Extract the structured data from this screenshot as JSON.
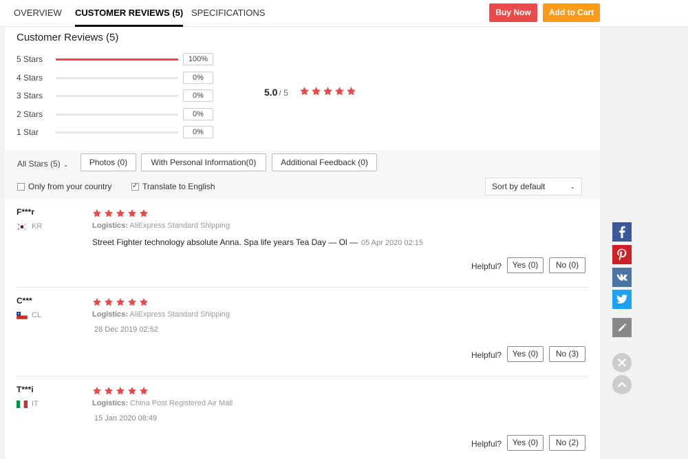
{
  "tabs": [
    {
      "label": "OVERVIEW"
    },
    {
      "label": "CUSTOMER REVIEWS (5)"
    },
    {
      "label": "SPECIFICATIONS"
    }
  ],
  "actions": {
    "buy_now": "Buy Now",
    "add_to_cart": "Add to Cart"
  },
  "colors": {
    "buy_now": "#e94b4b",
    "add_to_cart": "#fa9c1a",
    "star": "#e84a4a",
    "facebook": "#3b5998",
    "pinterest": "#cb2027",
    "vk": "#4c75a3",
    "twitter": "#1da1f2",
    "edit": "#888888"
  },
  "reviews_summary": {
    "title": "Customer Reviews (5)",
    "distribution": [
      {
        "label": "5 Stars",
        "percent_text": "100%",
        "fraction": 1.0
      },
      {
        "label": "4 Stars",
        "percent_text": "0%",
        "fraction": 0
      },
      {
        "label": "3 Stars",
        "percent_text": "0%",
        "fraction": 0
      },
      {
        "label": "2 Stars",
        "percent_text": "0%",
        "fraction": 0
      },
      {
        "label": "1 Star",
        "percent_text": "0%",
        "fraction": 0
      }
    ],
    "average": "5.0",
    "average_of": "/ 5",
    "average_stars": 5
  },
  "filters": {
    "all_stars": "All Stars (5)",
    "photos": "Photos (0)",
    "personal_info": "With Personal Information(0)",
    "additional_feedback": "Additional Feedback (0)",
    "only_country": {
      "label": "Only from your country",
      "checked": false
    },
    "translate": {
      "label": "Translate to English",
      "checked": true
    },
    "sort": "Sort by default"
  },
  "reviews": [
    {
      "name": "F***r",
      "country": "KR",
      "stars": 5,
      "logistics_label": "Logistics:",
      "logistics": "AliExpress Standard Shipping",
      "text": "Street Fighter technology absolute Anna. Spa life years Tea Day — Ol —",
      "date": "05 Apr 2020 02:15",
      "helpful_label": "Helpful?",
      "yes": "Yes (0)",
      "no": "No (0)"
    },
    {
      "name": "C***",
      "country": "CL",
      "stars": 5,
      "logistics_label": "Logistics:",
      "logistics": "AliExpress Standard Shipping",
      "text": "",
      "date": "28 Dec 2019 02:52",
      "helpful_label": "Helpful?",
      "yes": "Yes (0)",
      "no": "No (3)"
    },
    {
      "name": "T***i",
      "country": "IT",
      "stars": 5,
      "logistics_label": "Logistics:",
      "logistics": "China Post Registered Air Mail",
      "text": "",
      "date": "15 Jan 2020 08:49",
      "helpful_label": "Helpful?",
      "yes": "Yes (0)",
      "no": "No (2)"
    }
  ],
  "icons": {
    "star": "star-icon",
    "facebook": "facebook-icon",
    "pinterest": "pinterest-icon",
    "vk": "vk-icon",
    "twitter": "twitter-icon",
    "edit": "pencil-icon",
    "close": "close-icon",
    "up": "chevron-up-icon"
  }
}
